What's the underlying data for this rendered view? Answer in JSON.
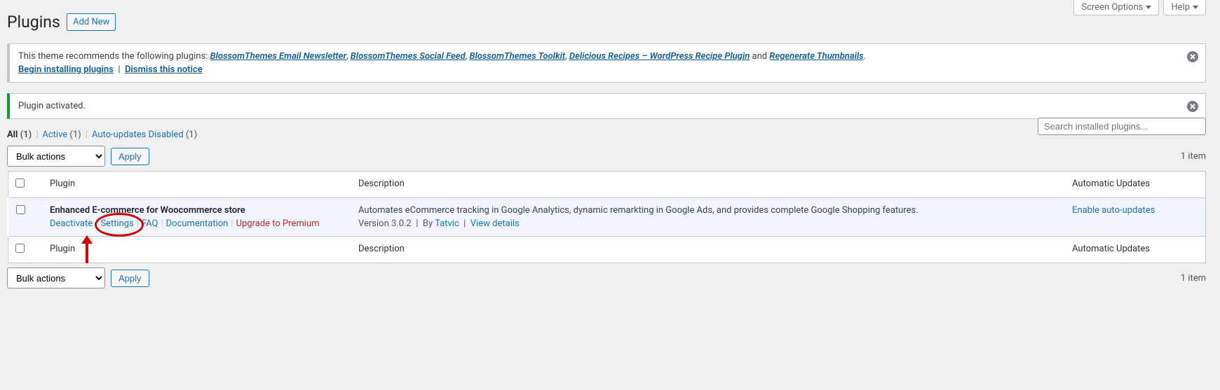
{
  "meta": {
    "screen_options": "Screen Options",
    "help": "Help"
  },
  "header": {
    "title": "Plugins",
    "add_new": "Add New"
  },
  "theme_notice": {
    "prefix": "This theme recommends the following plugins: ",
    "plugins": [
      "BlossomThemes Email Newsletter",
      "BlossomThemes Social Feed",
      "BlossomThemes Toolkit",
      "Delicious Recipes – WordPress Recipe Plugin"
    ],
    "and": " and ",
    "last_plugin": "Regenerate Thumbnails",
    "install_link": "Begin installing plugins",
    "dismiss_link": "Dismiss this notice"
  },
  "activated_notice": "Plugin activated.",
  "filters": {
    "all_label": "All",
    "all_count": "(1)",
    "active_label": "Active",
    "active_count": "(1)",
    "auto_label": "Auto-updates Disabled",
    "auto_count": "(1)"
  },
  "search": {
    "placeholder": "Search installed plugins..."
  },
  "bulk": {
    "label": "Bulk actions",
    "apply": "Apply"
  },
  "count_label": "1 item",
  "columns": {
    "plugin": "Plugin",
    "description": "Description",
    "auto": "Automatic Updates"
  },
  "plugin": {
    "name": "Enhanced E-commerce for Woocommerce store",
    "actions": {
      "deactivate": "Deactivate",
      "settings": "Settings",
      "faq": "FAQ",
      "documentation": "Documentation",
      "upgrade": "Upgrade to Premium"
    },
    "description": "Automates eCommerce tracking in Google Analytics, dynamic remarkting in Google Ads, and provides complete Google Shopping features.",
    "meta": {
      "version_label": "Version 3.0.2",
      "by": "By",
      "author": "Tatvic",
      "view_details": "View details"
    },
    "auto_link": "Enable auto-updates"
  }
}
